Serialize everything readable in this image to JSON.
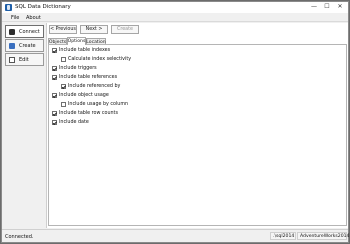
{
  "window": {
    "title": "SQL Data Dictionary",
    "minimize": "—",
    "maximize": "☐",
    "close": "✕"
  },
  "menu": [
    "File",
    "About"
  ],
  "sidebar": {
    "items": [
      {
        "label": "Connect",
        "icon": "database-icon",
        "active": true
      },
      {
        "label": "Create",
        "icon": "create-icon",
        "active": false
      },
      {
        "label": "Edit",
        "icon": "edit-icon",
        "active": false
      }
    ]
  },
  "toolbar": {
    "previous": "< Previous",
    "next": "Next >",
    "create": "Create"
  },
  "tabs": [
    {
      "label": "Objects",
      "active": false
    },
    {
      "label": "Options",
      "active": true
    },
    {
      "label": "Location",
      "active": false
    }
  ],
  "options": [
    {
      "label": "Include table indexes",
      "checked": true,
      "indent": 0
    },
    {
      "label": "Calculate index selectivity",
      "checked": false,
      "indent": 1
    },
    {
      "label": "Include triggers",
      "checked": true,
      "indent": 0
    },
    {
      "label": "Include table references",
      "checked": true,
      "indent": 0
    },
    {
      "label": "Include referenced by",
      "checked": true,
      "indent": 1
    },
    {
      "label": "Include object usage",
      "checked": true,
      "indent": 0
    },
    {
      "label": "Include usage by column",
      "checked": false,
      "indent": 1
    },
    {
      "label": "Include table row counts",
      "checked": true,
      "indent": 0
    },
    {
      "label": "Include date",
      "checked": true,
      "indent": 0
    }
  ],
  "status": {
    "message": "Connected.",
    "server": ".\\sql2014",
    "database": "AdventureWorks2014"
  }
}
